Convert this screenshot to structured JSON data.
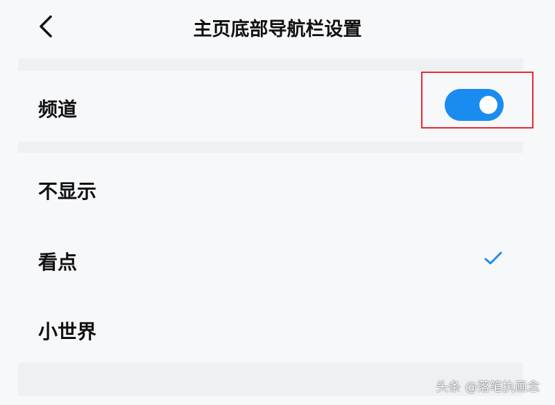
{
  "header": {
    "back_icon": "chevron-left-icon",
    "title": "主页底部导航栏设置"
  },
  "channel": {
    "label": "频道",
    "toggle_on": true,
    "toggle_color": "#1a8cf0",
    "highlight_color": "#e8262e"
  },
  "options": [
    {
      "label": "不显示",
      "selected": false
    },
    {
      "label": "看点",
      "selected": true
    },
    {
      "label": "小世界",
      "selected": false
    }
  ],
  "check_icon": "checkmark-icon",
  "check_color": "#1a8cf0",
  "watermark": "头条 @落笔执画念"
}
